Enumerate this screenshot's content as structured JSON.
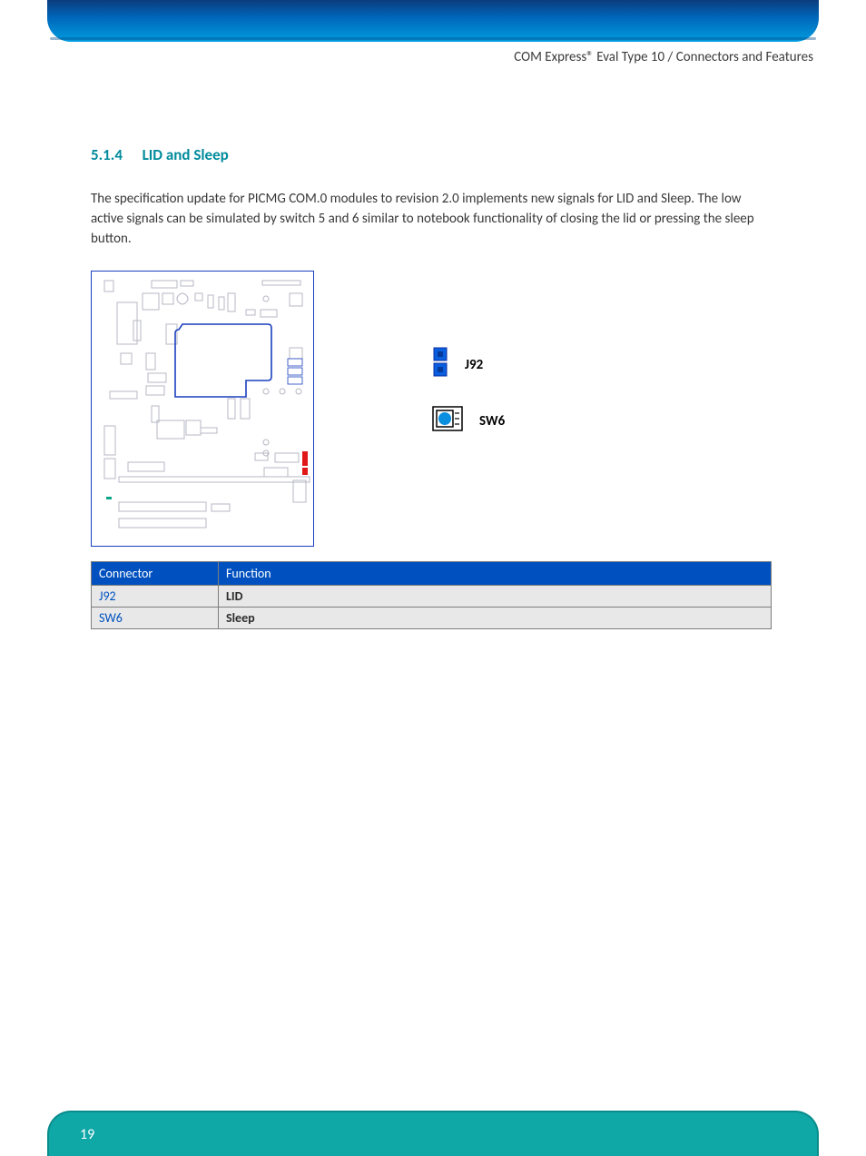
{
  "header": {
    "right": "COM Express® Eval Type 10 / Connectors and Features"
  },
  "section": {
    "number": "5.1.4",
    "title": "LID and Sleep",
    "paragraph": "The specification update for PICMG COM.0 modules to revision 2.0 implements new signals for LID and Sleep. The low active signals can be simulated by switch 5 and 6 similar to notebook functionality of closing the lid or pressing the sleep button."
  },
  "legend": {
    "j92": "J92",
    "sw6": "SW6"
  },
  "table": {
    "head": {
      "connector": "Connector",
      "function": "Function"
    },
    "rows": [
      {
        "connector": "J92",
        "function": "LID"
      },
      {
        "connector": "SW6",
        "function": "Sleep"
      }
    ]
  },
  "footer": {
    "page": "19"
  }
}
